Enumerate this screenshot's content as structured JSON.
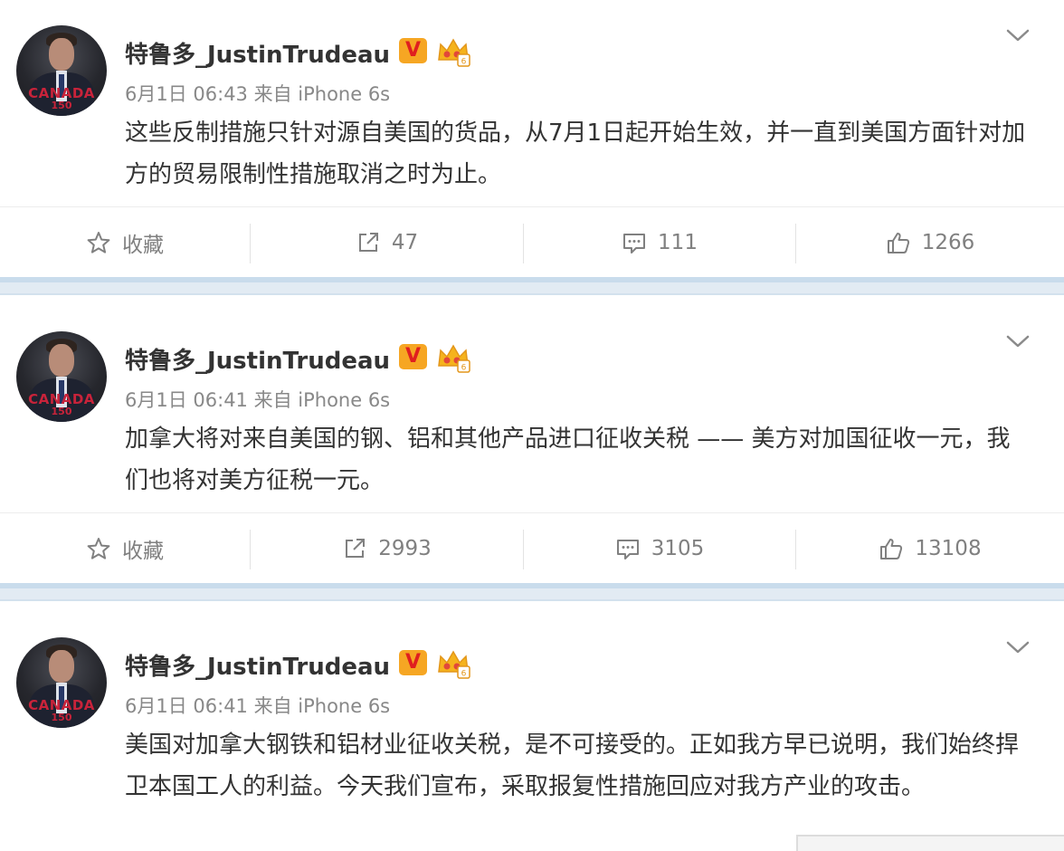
{
  "posts": [
    {
      "username": "特鲁多_JustinTrudeau",
      "verified_badge": "V",
      "avatar_caption": "CANADA",
      "avatar_caption2": "150",
      "meta": "6月1日 06:43 来自 iPhone 6s",
      "content": "这些反制措施只针对源自美国的货品，从7月1日起开始生效，并一直到美国方面针对加方的贸易限制性措施取消之时为止。",
      "actions": {
        "favorite": "收藏",
        "repost": "47",
        "comment": "111",
        "like": "1266"
      }
    },
    {
      "username": "特鲁多_JustinTrudeau",
      "verified_badge": "V",
      "avatar_caption": "CANADA",
      "avatar_caption2": "150",
      "meta": "6月1日 06:41 来自 iPhone 6s",
      "content": "加拿大将对来自美国的钢、铝和其他产品进口征收关税 —— 美方对加国征收一元，我们也将对美方征税一元。",
      "actions": {
        "favorite": "收藏",
        "repost": "2993",
        "comment": "3105",
        "like": "13108"
      }
    },
    {
      "username": "特鲁多_JustinTrudeau",
      "verified_badge": "V",
      "avatar_caption": "CANADA",
      "avatar_caption2": "150",
      "meta": "6月1日 06:41 来自 iPhone 6s",
      "content": "美国对加拿大钢铁和铝材业征收关税，是不可接受的。正如我方早已说明，我们始终捍卫本国工人的利益。今天我们宣布，采取报复性措施回应对我方产业的攻击。"
    }
  ],
  "colors": {
    "badge_v_bg": "#f6a623",
    "badge_v_text": "#e01f1f",
    "separator": "#e2ebf3",
    "meta_text": "#888888",
    "body_text": "#333333"
  },
  "icons": [
    "star-icon",
    "repost-icon",
    "comment-icon",
    "thumbs-up-icon",
    "chevron-down-icon",
    "crown-icon"
  ]
}
